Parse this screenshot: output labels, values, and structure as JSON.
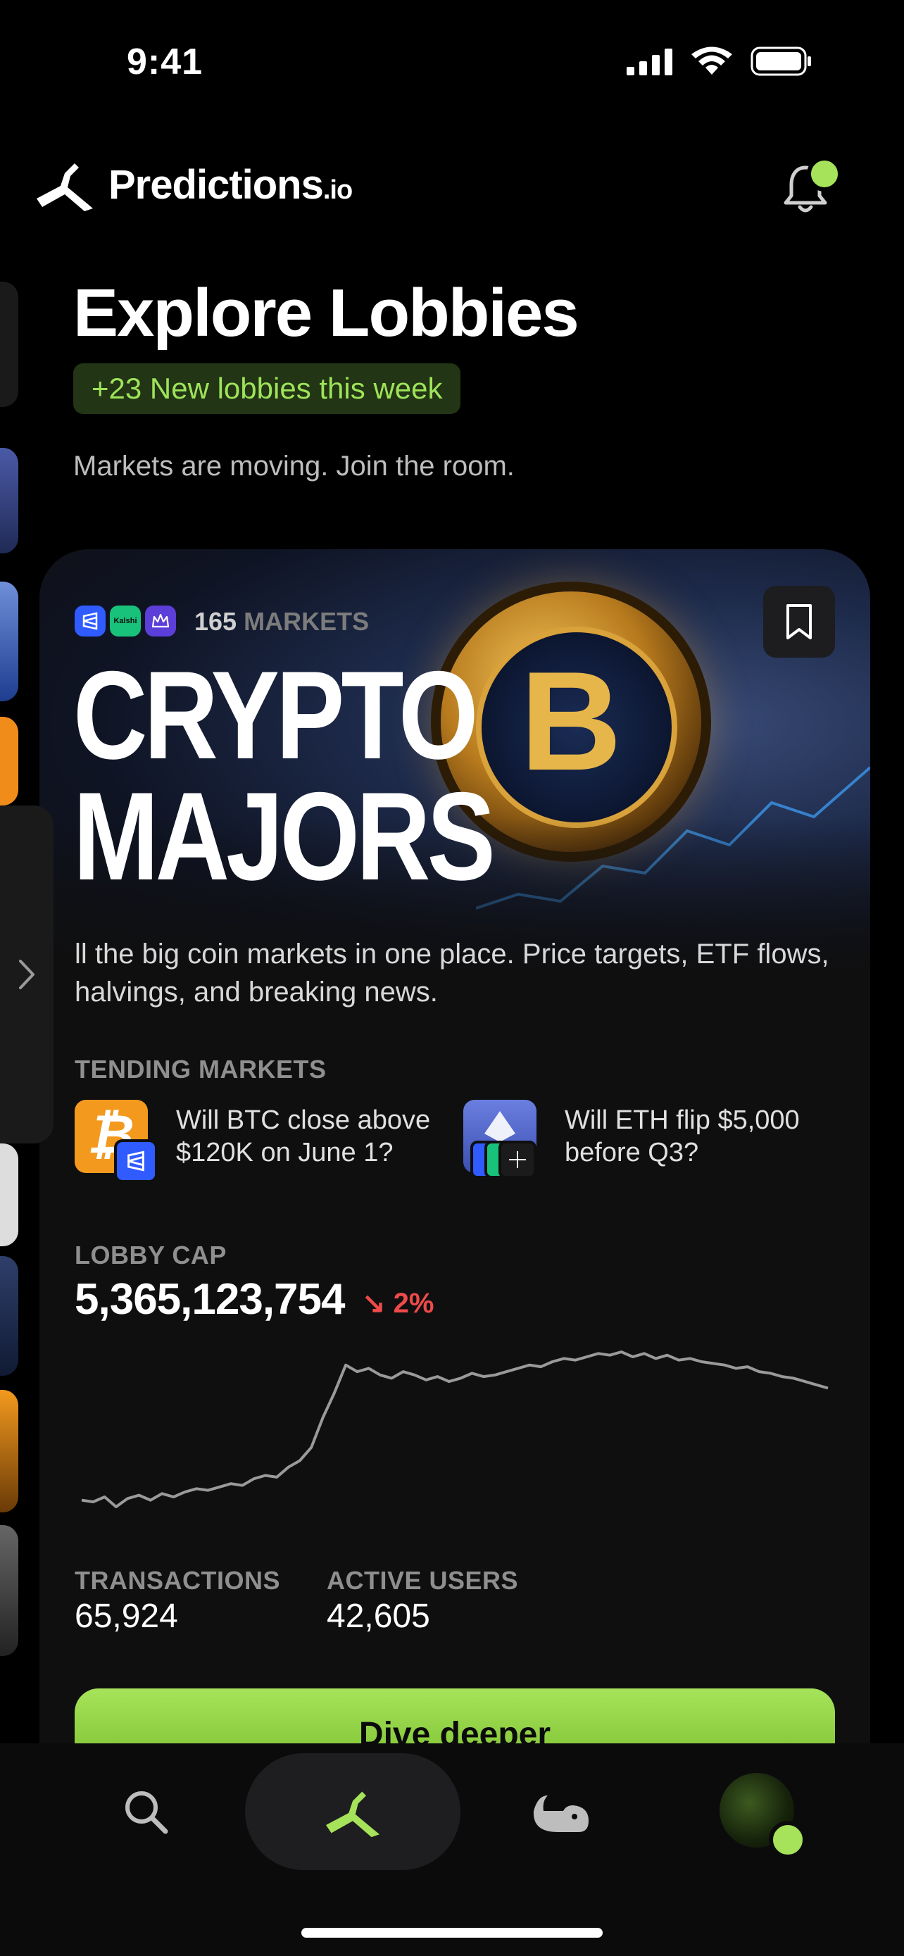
{
  "status_bar": {
    "time": "9:41"
  },
  "header": {
    "brand_name": "Predictions",
    "brand_suffix": ".io"
  },
  "page": {
    "title": "Explore Lobbies",
    "badge": "+23 New lobbies this week",
    "subtitle": "Markets are moving. Join the room."
  },
  "lobby": {
    "providers": [
      "polymarket-icon",
      "kalshi-icon",
      "crown-icon"
    ],
    "provider_kalshi_label": "Kalshi",
    "market_count": "165",
    "market_count_label": "MARKETS",
    "title_line1": "CRYPTO",
    "title_line2": "MAJORS",
    "description": "ll the big coin markets in one place. Price targets, ETF flows, halvings, and breaking news.",
    "trending_label": "TENDING MARKETS",
    "trending": [
      {
        "line1": "Will BTC close above",
        "line2": "$120K on June 1?"
      },
      {
        "line1": "Will ETH flip $5,000",
        "line2": "before Q3?"
      }
    ],
    "cap_label": "LOBBY CAP",
    "cap_value": "5,365,123,754",
    "cap_change": "2%",
    "transactions_label": "TRANSACTIONS",
    "transactions_value": "65,924",
    "active_users_label": "ACTIVE USERS",
    "active_users_value": "42,605",
    "cta_label": "Dive deeper"
  },
  "chart_data": {
    "type": "line",
    "title": "",
    "xlabel": "",
    "ylabel": "",
    "series": [
      {
        "values": [
          10,
          9,
          12,
          6,
          11,
          13,
          10,
          14,
          12,
          15,
          17,
          16,
          18,
          20,
          19,
          23,
          25,
          24,
          30,
          34,
          42,
          60,
          75,
          92,
          88,
          90,
          86,
          84,
          88,
          86,
          83,
          85,
          82,
          84,
          87,
          85,
          86,
          88,
          90,
          92,
          91,
          94,
          96,
          95,
          97,
          99,
          98,
          100,
          97,
          99,
          96,
          98,
          95,
          96,
          94,
          93,
          92,
          90,
          91,
          88,
          87,
          85,
          84,
          82,
          80,
          78
        ]
      }
    ],
    "color": "#9a9a9a"
  },
  "nav": {
    "items": [
      "search-icon",
      "predictions-icon",
      "whale-icon",
      "avatar"
    ]
  },
  "colors": {
    "accent": "#a6e35a",
    "negative": "#ef4a4a",
    "background": "#000000"
  }
}
